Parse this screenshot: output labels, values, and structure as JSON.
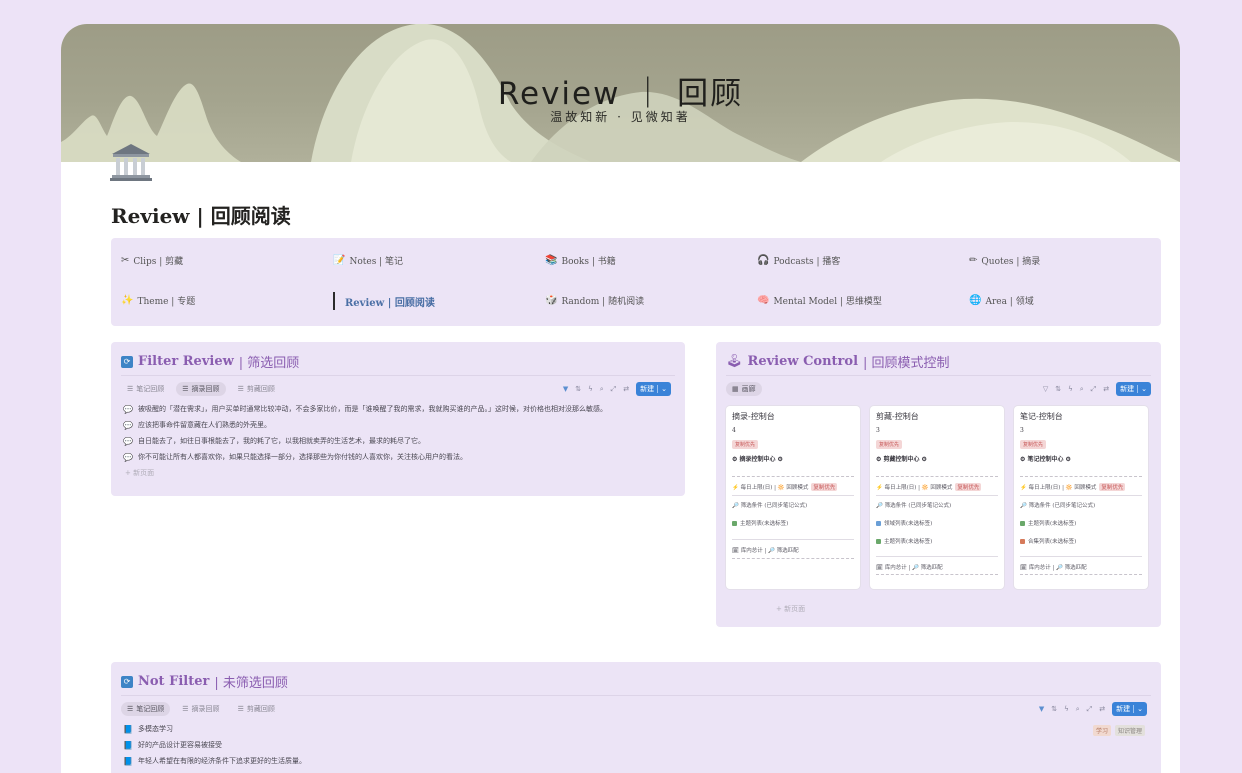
{
  "colors": {
    "background": "#ede3f7",
    "panel": "#ece4f6",
    "accent_title": "#8a5db0",
    "new_button": "#3a83d8",
    "active_nav": "#4a6fa5",
    "badge_red": "#c75a5a"
  },
  "cover": {
    "title": "Review ｜ 回顾",
    "subtitle": "温故知新 · 见微知著"
  },
  "page": {
    "icon": "building-columns-icon",
    "title": "Review | 回顾阅读"
  },
  "nav": {
    "items": [
      {
        "icon": "✂",
        "label": "Clips | 剪藏"
      },
      {
        "icon": "📝",
        "label": "Notes | 笔记"
      },
      {
        "icon": "📚",
        "label": "Books | 书籍"
      },
      {
        "icon": "🎧",
        "label": "Podcasts | 播客"
      },
      {
        "icon": "✏",
        "label": "Quotes | 摘录"
      },
      {
        "icon": "✨",
        "label": "Theme | 专题"
      },
      {
        "icon": "",
        "label": "Review | 回顾阅读"
      },
      {
        "icon": "🎲",
        "label": "Random | 随机阅读"
      },
      {
        "icon": "🧠",
        "label": "Mental Model | 思维模型"
      },
      {
        "icon": "🌐",
        "label": "Area | 领域"
      }
    ]
  },
  "filter_review": {
    "title_en": "Filter Review",
    "title_cn": " | 筛选回顾",
    "tabs": [
      "笔记回顾",
      "摘录回顾",
      "剪藏回顾"
    ],
    "new_label": "新建",
    "rows": [
      "被吸醒的「潜在需求」，用户买单时通常比较冲动，不会多家比价，而是「谁唤醒了我的需求，我就购买谁的产品。」这时候，对价格也相对没那么敏感。",
      "应该把事命件留意藏在人们熟悉的外壳里。",
      "自日能去了，如往日事根能去了，我的耗了它，以我相就卖弄的生活艺术，最求的耗尽了它。",
      "你不可能让所有人都喜欢你，如果只能选择一部分，选择那些为你付钱的人喜欢你，关注核心用户的看法。"
    ],
    "add_label": "+ 新页面"
  },
  "review_control": {
    "title_en": "Review Control",
    "title_cn": " | 回顾模式控制",
    "view_tab": "画廊",
    "new_label": "新建",
    "cards": [
      {
        "title": "摘录-控制台",
        "num": "4",
        "badge": "复制优先",
        "center": "⚙ 摘录控制中心 ⚙",
        "r1": "⚡ 每日上限(日) | 🔆 回顾模式",
        "r1_tag": "复制优先",
        "r2": "🔎 筛选条件 (已同步笔记公式)",
        "r3": "主题列表(未选标签)",
        "r3_color": "#6aa86a",
        "r4": "",
        "r4_color": "",
        "r5": "🗓 库内总计 | 🔎 筛选匹配"
      },
      {
        "title": "剪藏-控制台",
        "num": "3",
        "badge": "复制优先",
        "center": "⚙ 剪藏控制中心 ⚙",
        "r1": "⚡ 每日上限(日) | 🔆 回顾模式",
        "r1_tag": "复制优先",
        "r2": "🔎 筛选条件 (已同步笔记公式)",
        "r3": "领域列表(未选标签)",
        "r3_color": "#6a9fd6",
        "r4": "主题列表(未选标签)",
        "r4_color": "#6aa86a",
        "r5": "🗓 库内总计 | 🔎 筛选匹配"
      },
      {
        "title": "笔记-控制台",
        "num": "3",
        "badge": "复制优先",
        "center": "⚙ 笔记控制中心 ⚙",
        "r1": "⚡ 每日上限(日) | 🔆 回顾模式",
        "r1_tag": "复制优先",
        "r2": "🔎 筛选条件 (已同步笔记公式)",
        "r3": "主题列表(未选标签)",
        "r3_color": "#6aa86a",
        "r4": "合集列表(未选标签)",
        "r4_color": "#d67a5a",
        "r5": "🗓 库内总计 | 🔎 筛选匹配"
      }
    ],
    "add_label": "+ 新页面"
  },
  "not_filter": {
    "title_en": "Not Filter",
    "title_cn": " | 未筛选回顾",
    "tabs": [
      "笔记回顾",
      "摘录回顾",
      "剪藏回顾"
    ],
    "new_label": "新建",
    "rows": [
      "多模态学习",
      "好的产品设计更容易被接受",
      "年轻人希望在有限的经济条件下追求更好的生活质量。"
    ],
    "tags": [
      "学习",
      "知识管理"
    ]
  }
}
